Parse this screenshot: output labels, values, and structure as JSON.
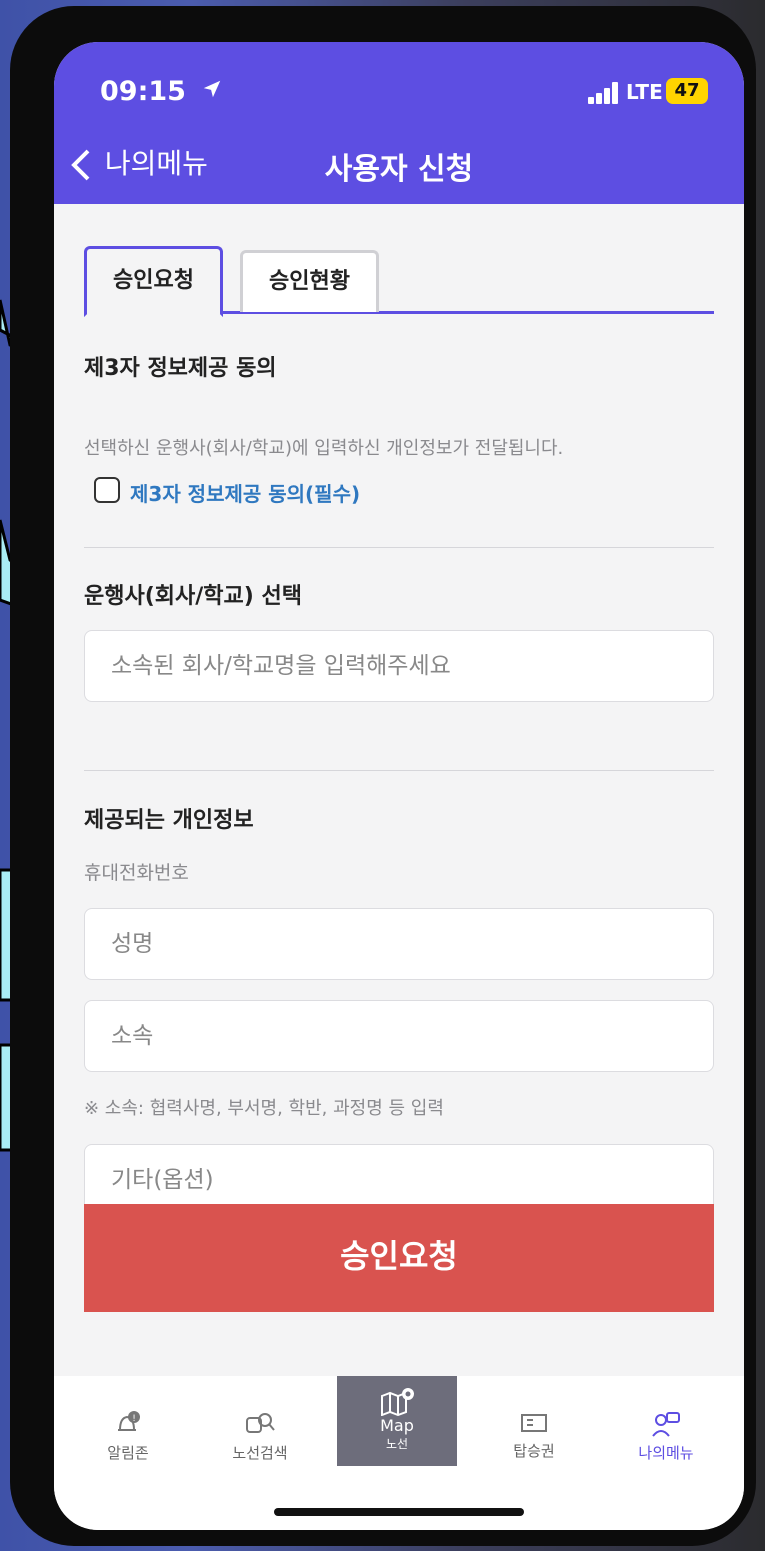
{
  "status_bar": {
    "time": "09:15",
    "network": "LTE",
    "battery": "47"
  },
  "header": {
    "back_label": "나의메뉴",
    "title": "사용자 신청"
  },
  "tabs": [
    {
      "label": "승인요청",
      "active": true
    },
    {
      "label": "승인현황",
      "active": false
    }
  ],
  "consent": {
    "title": "제3자 정보제공 동의",
    "description": "선택하신 운행사(회사/학교)에 입력하신 개인정보가 전달됩니다.",
    "checkbox_label": "제3자 정보제공 동의(필수)",
    "checked": false
  },
  "operator": {
    "title": "운행사(회사/학교) 선택",
    "placeholder": "소속된 회사/학교명을 입력해주세요"
  },
  "personal_info": {
    "title": "제공되는 개인정보",
    "phone_label": "휴대전화번호",
    "name_placeholder": "성명",
    "affiliation_placeholder": "소속",
    "note": "※ 소속: 협력사명, 부서명, 학반, 과정명 등 입력",
    "other_placeholder": "기타(옵션)"
  },
  "submit_label": "승인요청",
  "bottom_nav": {
    "items": [
      {
        "label": "알림존",
        "icon": "bell-icon"
      },
      {
        "label": "노선검색",
        "icon": "bus-search-icon"
      },
      {
        "label": "Map",
        "sublabel": "노선",
        "icon": "map-icon",
        "highlighted": true
      },
      {
        "label": "탑승권",
        "icon": "ticket-icon"
      },
      {
        "label": "나의메뉴",
        "icon": "user-menu-icon",
        "active": true
      }
    ]
  },
  "colors": {
    "accent": "#5d4ee2",
    "submit": "#d9534f",
    "link": "#2f78c0",
    "callout": "#a9ecf4"
  }
}
